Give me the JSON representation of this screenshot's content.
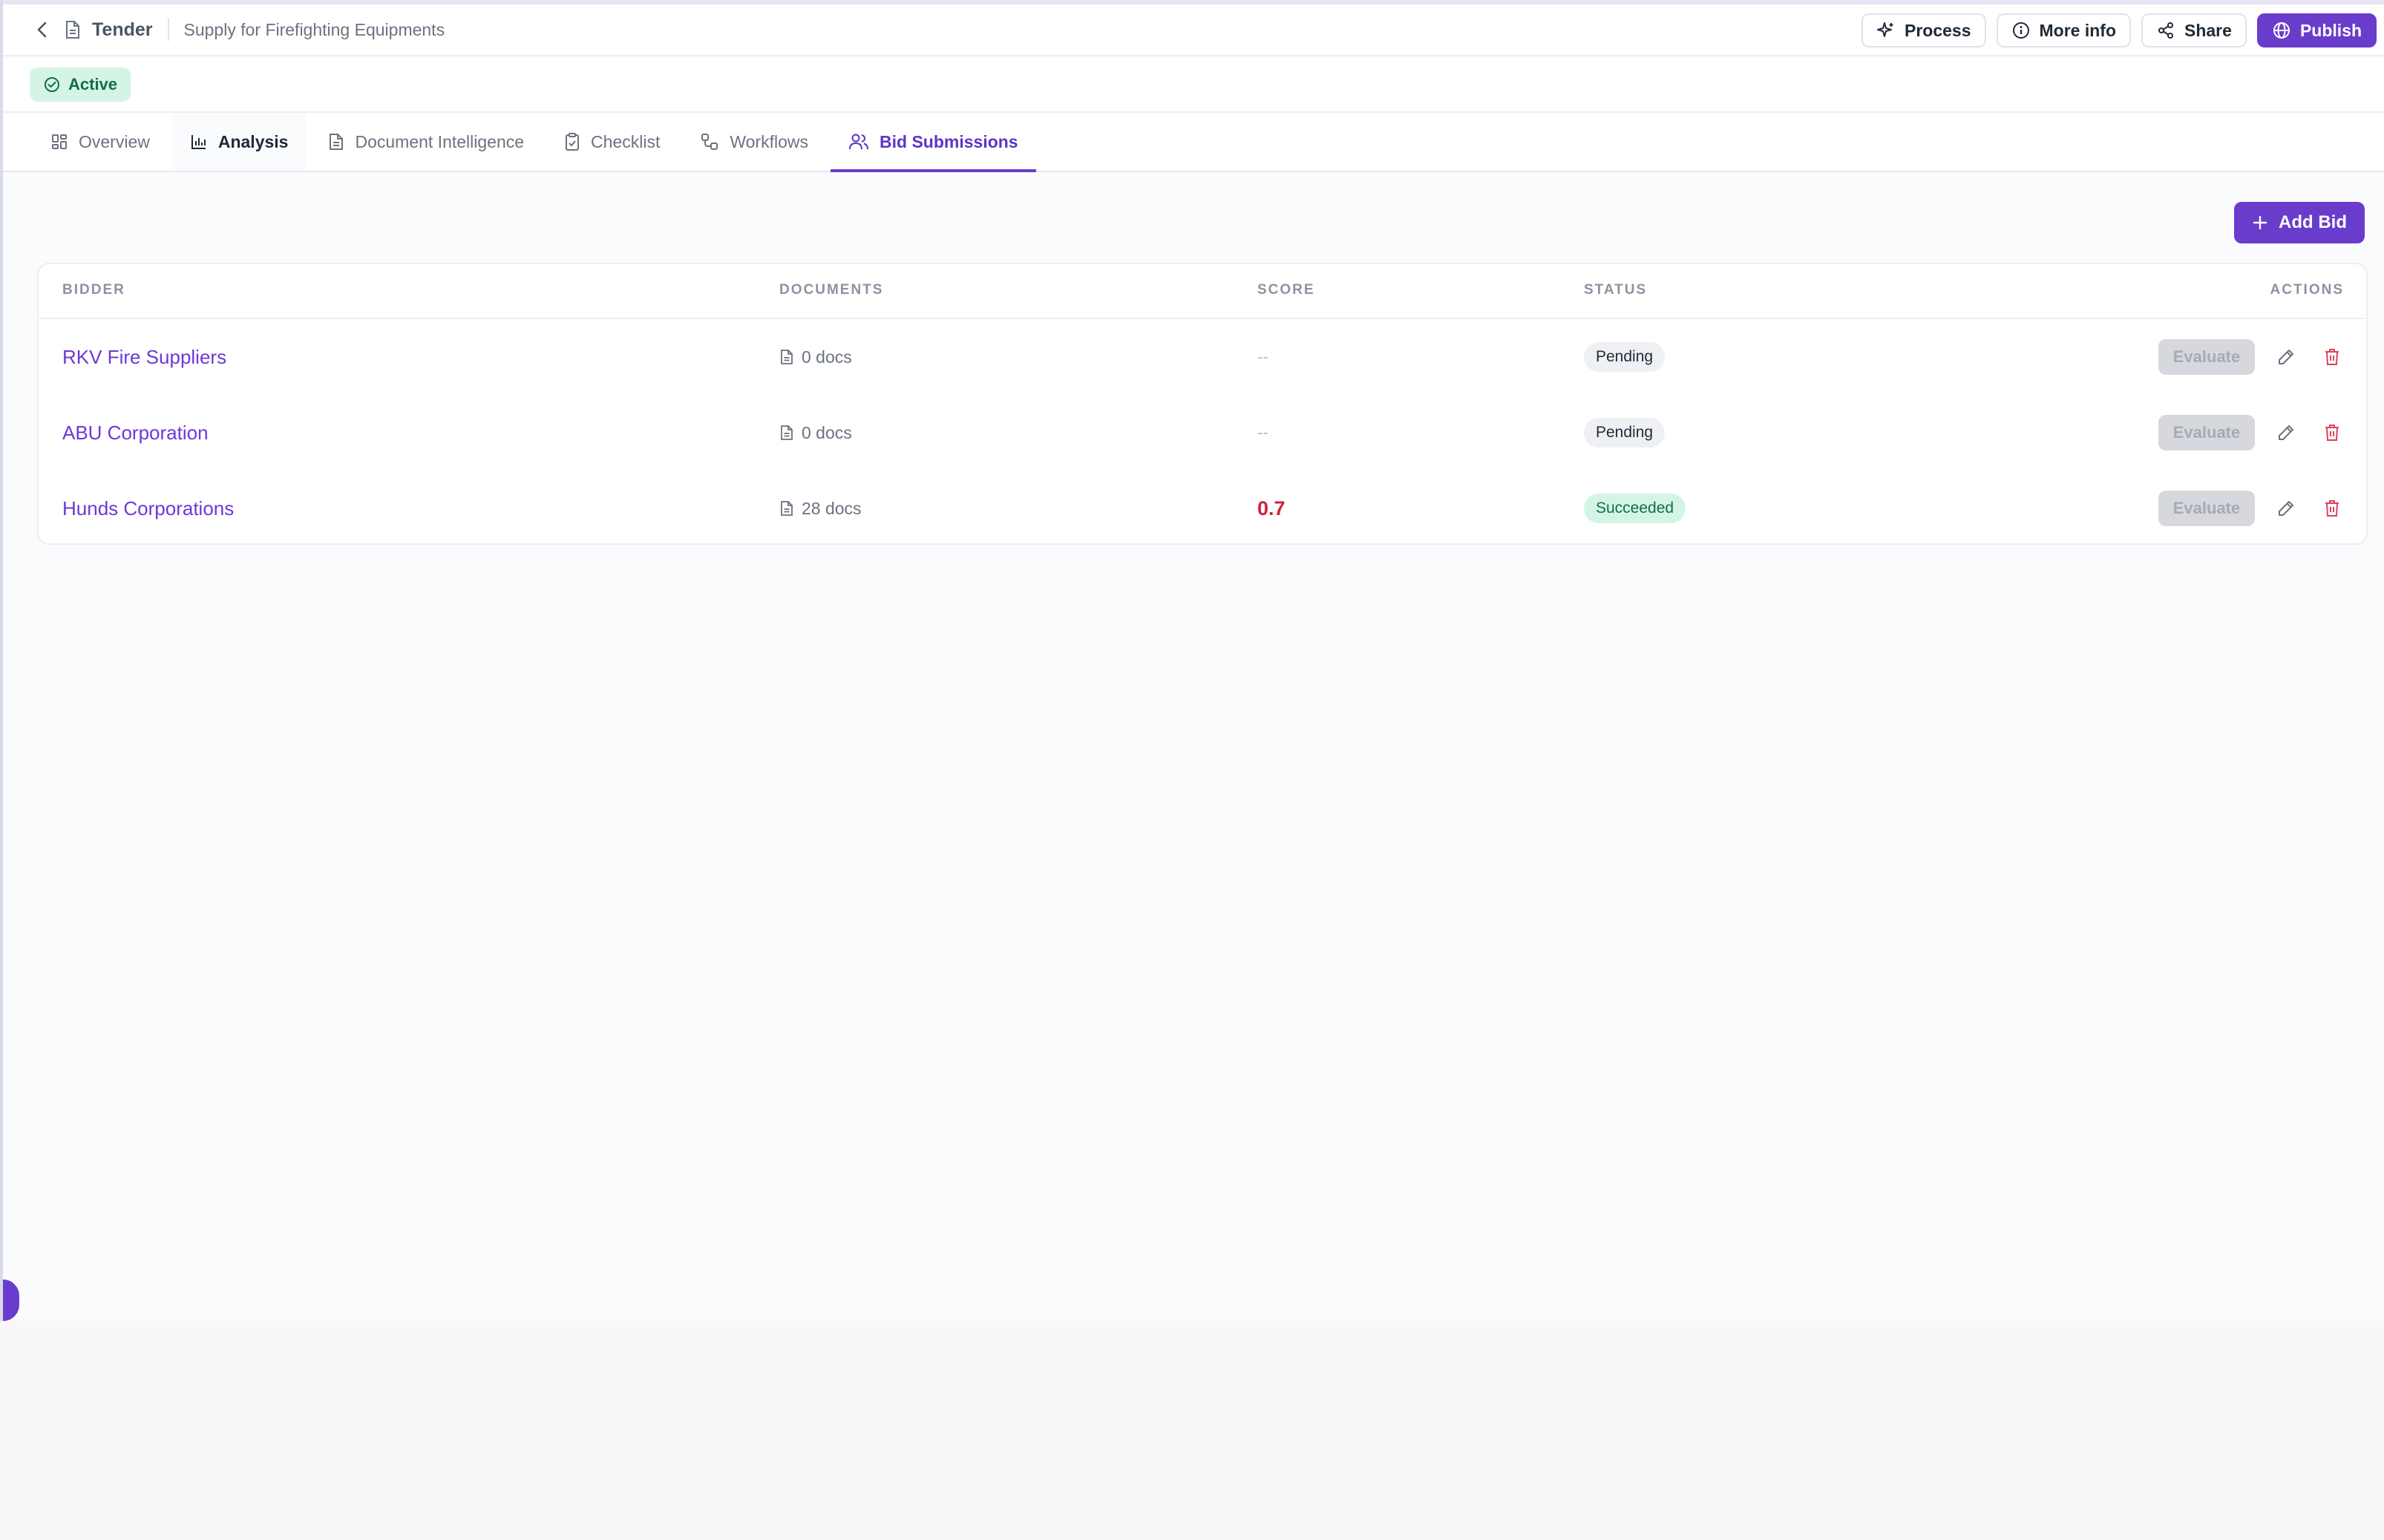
{
  "header": {
    "title": "Tender",
    "subtitle": "Supply for Firefighting Equipments",
    "actions": [
      {
        "label": "Process",
        "icon": "sparkle-icon"
      },
      {
        "label": "More info",
        "icon": "info-icon"
      },
      {
        "label": "Share",
        "icon": "share-icon"
      },
      {
        "label": "Publish",
        "icon": "globe-icon"
      }
    ]
  },
  "status": {
    "label": "Active"
  },
  "tabs": [
    {
      "label": "Overview",
      "icon": "grid-icon"
    },
    {
      "label": "Analysis",
      "icon": "bar-chart-icon"
    },
    {
      "label": "Document Intelligence",
      "icon": "document-icon"
    },
    {
      "label": "Checklist",
      "icon": "clipboard-check-icon"
    },
    {
      "label": "Workflows",
      "icon": "workflow-icon"
    },
    {
      "label": "Bid Submissions",
      "icon": "users-icon"
    }
  ],
  "active_tab": "Bid Submissions",
  "add_bid_label": "Add Bid",
  "table": {
    "columns": [
      "BIDDER",
      "DOCUMENTS",
      "SCORE",
      "STATUS",
      "ACTIONS"
    ],
    "rows": [
      {
        "bidder": "RKV Fire Suppliers",
        "documents": "0 docs",
        "score": "--",
        "status": "Pending",
        "action": "Evaluate"
      },
      {
        "bidder": "ABU Corporation",
        "documents": "0 docs",
        "score": "--",
        "status": "Pending",
        "action": "Evaluate"
      },
      {
        "bidder": "Hunds Corporations",
        "documents": "28 docs",
        "score": "0.7",
        "status": "Succeeded",
        "action": "Evaluate"
      }
    ]
  },
  "colors": {
    "accent": "#6a3ccc",
    "link": "#6d38d9",
    "danger": "#d0223b",
    "success_bg": "#d4f5e5"
  }
}
